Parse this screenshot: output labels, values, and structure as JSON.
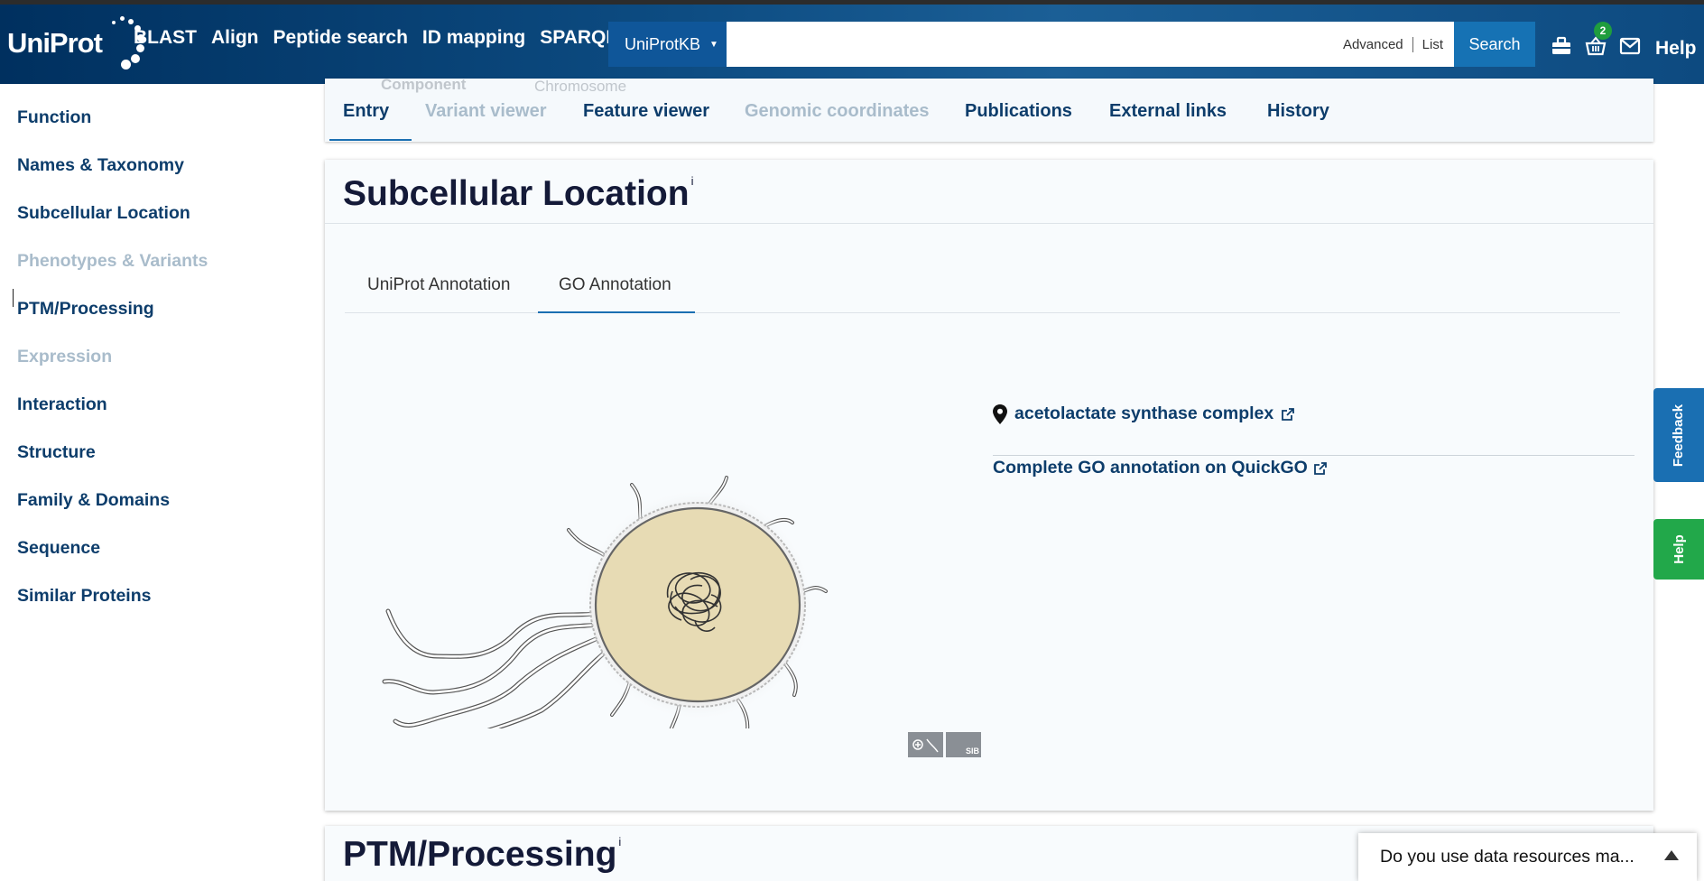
{
  "header": {
    "logo_text": "UniProt",
    "nav": [
      "BLAST",
      "Align",
      "Peptide search",
      "ID mapping",
      "SPARQL"
    ],
    "dataset": "UniProtKB",
    "search_value": "",
    "advanced_label": "Advanced",
    "list_label": "List",
    "search_button": "Search",
    "basket_count": "2",
    "help_label": "Help",
    "icons": [
      "tools-icon",
      "basket-icon",
      "mail-icon"
    ]
  },
  "sidebar": {
    "items": [
      {
        "label": "Function",
        "enabled": true
      },
      {
        "label": "Names & Taxonomy",
        "enabled": true
      },
      {
        "label": "Subcellular Location",
        "enabled": true
      },
      {
        "label": "Phenotypes & Variants",
        "enabled": false
      },
      {
        "label": "PTM/Processing",
        "enabled": true
      },
      {
        "label": "Expression",
        "enabled": false
      },
      {
        "label": "Interaction",
        "enabled": true
      },
      {
        "label": "Structure",
        "enabled": true
      },
      {
        "label": "Family & Domains",
        "enabled": true
      },
      {
        "label": "Sequence",
        "enabled": true
      },
      {
        "label": "Similar Proteins",
        "enabled": true
      }
    ]
  },
  "entry_tabs": {
    "items": [
      {
        "label": "Entry",
        "enabled": true,
        "active": true
      },
      {
        "label": "Variant viewer",
        "enabled": false
      },
      {
        "label": "Feature viewer",
        "enabled": true
      },
      {
        "label": "Genomic coordinates",
        "enabled": false
      },
      {
        "label": "Publications",
        "enabled": true
      },
      {
        "label": "External links",
        "enabled": true
      },
      {
        "label": "History",
        "enabled": true
      }
    ],
    "ghost_labels": [
      "Component",
      "Chromosome"
    ]
  },
  "subcellular": {
    "title": "Subcellular Location",
    "info_mark": "i",
    "tabs": [
      {
        "label": "UniProt Annotation",
        "active": false
      },
      {
        "label": "GO Annotation",
        "active": true
      }
    ],
    "go_term": "acetolactate synthase complex",
    "quickgo_link": "Complete GO annotation on QuickGO",
    "logo_label": "SIB"
  },
  "next_section": {
    "title": "PTM/Processing",
    "info_mark": "i"
  },
  "side_tabs": {
    "feedback": "Feedback",
    "help": "Help"
  },
  "survey": {
    "text": "Do you use data resources ma..."
  },
  "colors": {
    "header_dark": "#00305f",
    "link": "#0d3d6b",
    "disabled": "#a9bccb",
    "accent": "#1a6fb2",
    "feedback": "#1a6fb2",
    "help_tab": "#22a84a",
    "cell_fill": "#e7dbb4"
  }
}
